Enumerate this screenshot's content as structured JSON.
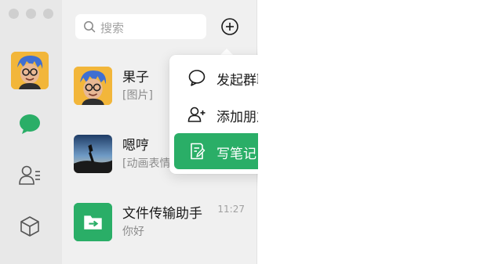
{
  "window": {
    "traffic_lights": [
      "close",
      "minimize",
      "zoom"
    ]
  },
  "sidebar": {
    "items": [
      {
        "name": "avatar"
      },
      {
        "name": "chats-icon",
        "active": true
      },
      {
        "name": "contacts-icon"
      },
      {
        "name": "mini-programs-icon"
      }
    ],
    "accent_color": "#2aae67"
  },
  "search": {
    "placeholder": "搜索"
  },
  "chats": [
    {
      "name": "果子",
      "preview": "[图片]",
      "time": ""
    },
    {
      "name": "嗯哼",
      "preview": "[动画表情]",
      "time": ""
    },
    {
      "name": "文件传输助手",
      "preview": "你好",
      "time": "11:27"
    }
  ],
  "menu": {
    "items": [
      {
        "label": "发起群聊",
        "icon": "speech-bubble-icon",
        "active": false
      },
      {
        "label": "添加朋友",
        "icon": "add-friend-icon",
        "active": false
      },
      {
        "label": "写笔记",
        "icon": "note-icon",
        "active": true
      }
    ]
  }
}
